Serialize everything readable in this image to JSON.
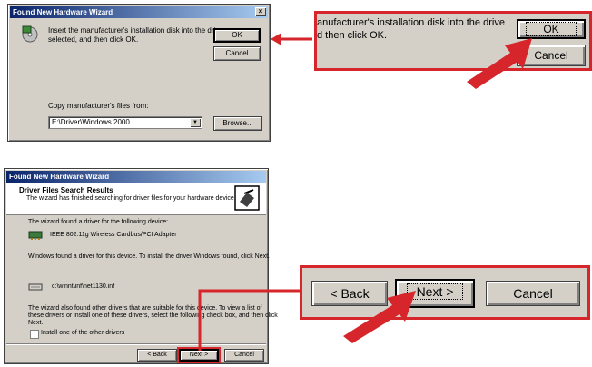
{
  "dialog1": {
    "title": "Found New Hardware Wizard",
    "close_glyph": "×",
    "message_line1": "Insert the manufacturer's installation disk into the drive",
    "message_line2": "selected, and then click OK.",
    "ok_label": "OK",
    "cancel_label": "Cancel",
    "copy_label": "Copy manufacturer's files from:",
    "path_value": "E:\\Driver\\Windows 2000",
    "browse_label": "Browse..."
  },
  "callout1": {
    "line1": "anufacturer's installation disk into the drive",
    "line2": "d then click OK.",
    "ok_label": "OK",
    "cancel_label": "Cancel"
  },
  "dialog2": {
    "title": "Found New Hardware Wizard",
    "header_title": "Driver Files Search Results",
    "header_subtitle": "The wizard has finished searching for driver files for your hardware device.",
    "found_text": "The wizard found a driver for the following device:",
    "device_name": "IEEE 802.11g Wireless Cardbus/PCI Adapter",
    "windows_found_text": "Windows found a driver for this device. To install the driver Windows found, click Next.",
    "driver_path": "c:\\winnt\\inf\\net1130.inf",
    "also_found_line1": "The wizard also found other drivers that are suitable for this device. To view a list of",
    "also_found_line2": "these drivers or install one of these drivers, select the following check box, and then click",
    "also_found_line3": "Next.",
    "checkbox_label": "Install one of the other drivers",
    "back_label": "< Back",
    "next_label": "Next >",
    "cancel_label": "Cancel"
  },
  "callout2": {
    "back_label": "< Back",
    "next_label": "Next >",
    "cancel_label": "Cancel"
  },
  "colors": {
    "accent": "#d7262b",
    "title_start": "#0a246a",
    "title_end": "#a6caf0",
    "face": "#d4d0c8"
  }
}
